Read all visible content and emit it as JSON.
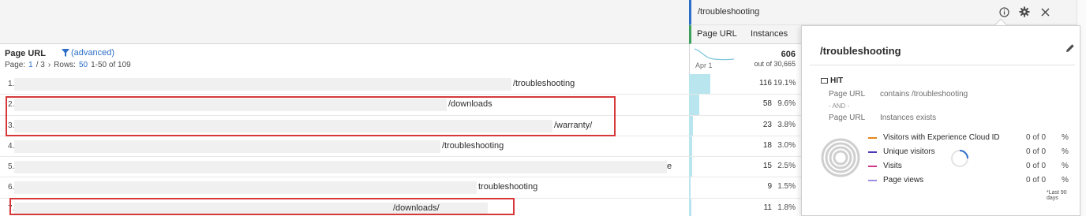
{
  "segment": {
    "title": "/troubleshooting",
    "columns": [
      "Page URL",
      "Instances"
    ],
    "colors": {
      "segment_bar": "#2d6ec7",
      "metric_bar": "#3aa05a"
    }
  },
  "table": {
    "dimension": "Page URL",
    "filter_label": "(advanced)",
    "pager": {
      "page_label": "Page:",
      "current": "1",
      "total": "/ 3",
      "rows_label": "Rows:",
      "rows": "50",
      "range": "1-50 of 109"
    },
    "summary": {
      "date": "Apr 1",
      "total": "606",
      "of": "out of 30,665"
    },
    "rows": [
      {
        "num": "1.",
        "url": "/troubleshooting",
        "value": "116",
        "pct": "19.1%",
        "fill": 0.191
      },
      {
        "num": "2.",
        "url": "/downloads",
        "value": "58",
        "pct": "9.6%",
        "fill": 0.096
      },
      {
        "num": "3.",
        "url": "/warranty/",
        "value": "23",
        "pct": "3.8%",
        "fill": 0.038
      },
      {
        "num": "4.",
        "url": "/troubleshooting",
        "value": "18",
        "pct": "3.0%",
        "fill": 0.03
      },
      {
        "num": "5.",
        "url": "e",
        "value": "15",
        "pct": "2.5%",
        "fill": 0.025
      },
      {
        "num": "6.",
        "url": "troubleshooting",
        "value": "9",
        "pct": "1.5%",
        "fill": 0.015
      },
      {
        "num": "7.",
        "url": "/downloads/",
        "value": "11",
        "pct": "1.8%",
        "fill": 0.018
      }
    ]
  },
  "popover": {
    "title": "/troubleshooting",
    "container": "HIT",
    "rules": [
      {
        "dimension": "Page URL",
        "condition": "contains /troubleshooting"
      },
      {
        "dimension": "Page URL",
        "condition": "Instances exists"
      }
    ],
    "and_label": "- AND -",
    "metrics": [
      {
        "label": "Visitors with Experience Cloud ID",
        "value": "0 of 0",
        "pct": "%",
        "color": "#e68619"
      },
      {
        "label": "Unique visitors",
        "value": "0 of 0",
        "pct": "%",
        "color": "#4b3bb5"
      },
      {
        "label": "Visits",
        "value": "0 of 0",
        "pct": "%",
        "color": "#d1368c"
      },
      {
        "label": "Page views",
        "value": "0 of 0",
        "pct": "%",
        "color": "#9b8de0"
      }
    ],
    "footnote": "*Last 90 days"
  }
}
